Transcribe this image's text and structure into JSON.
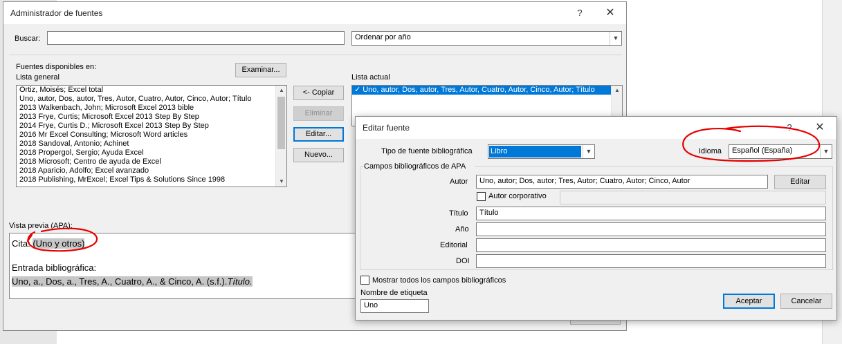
{
  "main": {
    "title": "Administrador de fuentes",
    "help_glyph": "?",
    "close_glyph": "✕",
    "search": {
      "label": "Buscar:",
      "value": ""
    },
    "sort": {
      "value": "Ordenar por año"
    },
    "sources_available_label": "Fuentes disponibles en:",
    "master_list_label": "Lista general",
    "browse_button": "Examinar...",
    "master_list": [
      "Ortiz, Moisés; Excel total",
      "Uno, autor, Dos, autor, Tres, Autor, Cuatro, Autor, Cinco, Autor; Título",
      "2013 Walkenbach, John; Microsoft Excel 2013 bible",
      "2013 Frye, Curtis; Microsoft Excel 2013 Step By Step",
      "2014 Frye, Curtis D.; Microsoft Excel 2013 Step By Step",
      "2016 Mr Excel Consulting; Microsoft Word articles",
      "2018 Sandoval, Antonio; Achinet",
      "2018 Propergol, Sergio; Ayuda Excel",
      "2018 Microsoft; Centro de ayuda de Excel",
      "2018 Aparicio, Adolfo; Excel avanzado",
      "2018 Publishing, MrExcel; Excel Tips & Solutions Since 1998"
    ],
    "copy_button": "<- Copiar",
    "delete_button": "Eliminar",
    "edit_button": "Editar...",
    "new_button": "Nuevo...",
    "current_list_label": "Lista actual",
    "current_list": [
      {
        "check": "✓",
        "text": "Uno, autor, Dos, autor, Tres, Autor, Cuatro, Autor, Cinco, Autor; Título"
      }
    ],
    "preview_label": "Vista previa (APA):",
    "preview": {
      "citation_label": "Cita: ",
      "citation": "(Uno y otros)",
      "bib_label": "Entrada bibliográfica:",
      "bib_text": "Uno, a., Dos, a., Tres, A., Cuatro, A., & Cinco, A. (s.f.).",
      "bib_title": "Título."
    }
  },
  "edit": {
    "title": "Editar fuente",
    "help_glyph": "?",
    "close_glyph": "✕",
    "type_label": "Tipo de fuente bibliográfica",
    "type_value": "Libro",
    "language_label": "Idioma",
    "language_value": "Español (España)",
    "fields_group_label": "Campos bibliográficos de APA",
    "author_label": "Autor",
    "author_value": "Uno, autor; Dos, autor; Tres, Autor; Cuatro, Autor; Cinco, Autor",
    "author_edit_button": "Editar",
    "corporate_author_label": "Autor corporativo",
    "title_label": "Título",
    "title_value": "Título",
    "year_label": "Año",
    "publisher_label": "Editorial",
    "doi_label": "DOI",
    "show_all_label": "Mostrar todos los campos bibliográficos",
    "tag_name_label": "Nombre de etiqueta",
    "tag_name_value": "Uno",
    "accept_button": "Aceptar",
    "cancel_button": "Cancelar"
  },
  "colors": {
    "selection": "#0078d7",
    "annotation": "#e60000",
    "dialog_bg": "#f0f0f0"
  }
}
